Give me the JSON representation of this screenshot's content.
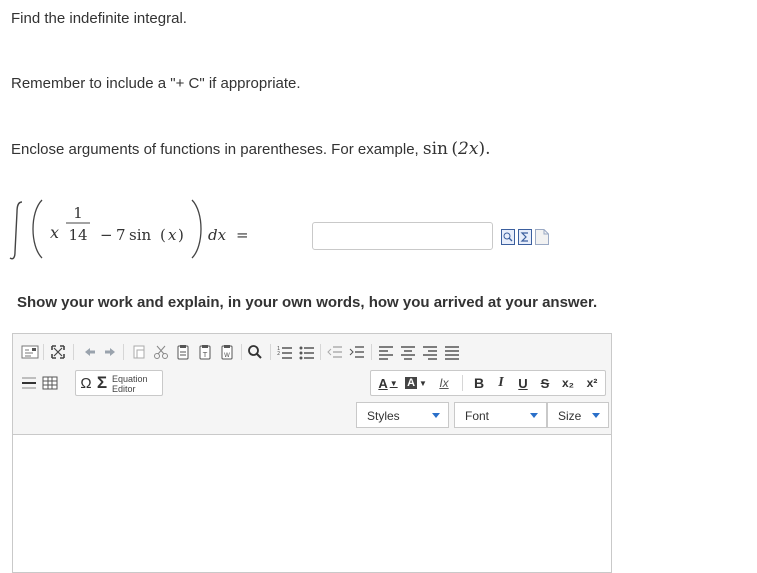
{
  "instructions": {
    "line1": "Find the indefinite integral.",
    "line2": "Remember to include a \"+ C\" if appropriate.",
    "line3_text": "Enclose arguments of functions in parentheses. For example,",
    "line3_example": "sin (2x).",
    "line3_sin": "sin",
    "line3_arg": "2x"
  },
  "integral": {
    "numerator": "1",
    "var": "x",
    "denominator": "14",
    "minus": "−",
    "coef": "7",
    "func": "sin",
    "arg": "x",
    "dx": "dx",
    "equals": "="
  },
  "answer": {
    "value": "",
    "placeholder": ""
  },
  "answer_icons": [
    "preview-icon",
    "sigma-icon",
    "doc-icon"
  ],
  "work_prompt": "Show your work and explain, in your own words, how you arrived at your answer.",
  "editor": {
    "equation_editor_line1": "Equation",
    "equation_editor_line2": "Editor",
    "styles_label": "Styles",
    "font_label": "Font",
    "size_label": "Size",
    "text_color": "A",
    "bg_color": "A",
    "bold": "B",
    "italic": "I",
    "underline": "U",
    "strike": "S",
    "subscript": "x₂",
    "superscript": "x²",
    "omega": "Ω",
    "sigma": "Σ",
    "remove_format": "Ix",
    "content": ""
  },
  "colors": {
    "accent": "#2a6fc9",
    "text": "#333333",
    "border": "#c9c9c9",
    "toolbar_bg": "#f5f5f5"
  }
}
